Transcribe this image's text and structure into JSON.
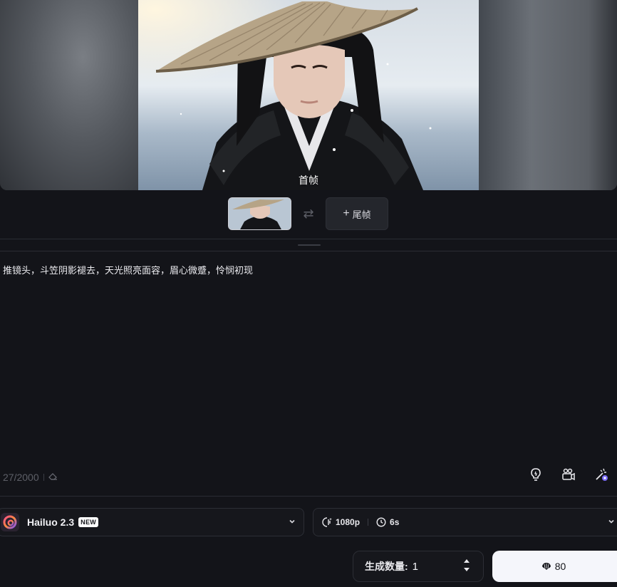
{
  "preview": {
    "frame_label": "首帧"
  },
  "frames": {
    "start_alt": "首帧缩略图",
    "end_label": "尾帧",
    "swap_icon": "swap-icon"
  },
  "prompt": {
    "text": "推镜头，斗笠阴影褪去，天光照亮面容，眉心微蹙，怜悯初现",
    "counter": "27/2000"
  },
  "tools": [
    "lightbulb-icon",
    "camera-movement-icon",
    "magic-wand-icon"
  ],
  "model": {
    "name": "Hailuo 2.3",
    "badge": "NEW"
  },
  "settings": {
    "resolution": "1080p",
    "duration": "6s"
  },
  "generation": {
    "count_label": "生成数量:",
    "count_value": "1",
    "cost": "80"
  },
  "colors": {
    "background": "#131419",
    "generate_button": "#f5f6fb"
  }
}
